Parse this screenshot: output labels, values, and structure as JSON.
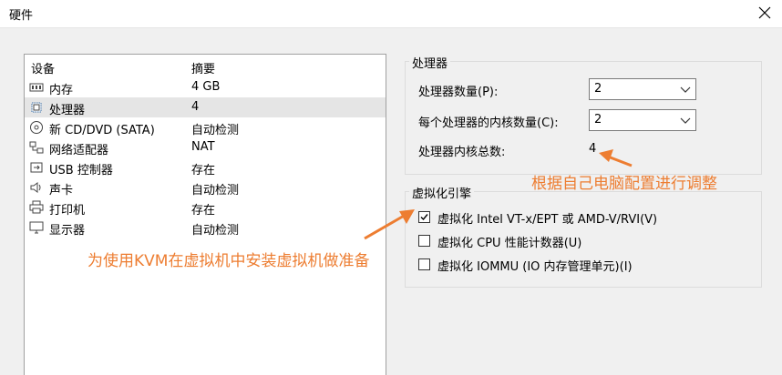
{
  "window": {
    "title": "硬件"
  },
  "device_list": {
    "headers": {
      "device": "设备",
      "summary": "摘要"
    },
    "rows": [
      {
        "name": "内存",
        "summary": "4 GB",
        "icon": "memory-icon"
      },
      {
        "name": "处理器",
        "summary": "4",
        "icon": "processor-icon",
        "selected": true
      },
      {
        "name": "新 CD/DVD (SATA)",
        "summary": "自动检测",
        "icon": "cd-dvd-icon"
      },
      {
        "name": "网络适配器",
        "summary": "NAT",
        "icon": "network-adapter-icon"
      },
      {
        "name": "USB 控制器",
        "summary": "存在",
        "icon": "usb-icon"
      },
      {
        "name": "声卡",
        "summary": "自动检测",
        "icon": "speaker-icon"
      },
      {
        "name": "打印机",
        "summary": "存在",
        "icon": "printer-icon"
      },
      {
        "name": "显示器",
        "summary": "自动检测",
        "icon": "monitor-icon"
      }
    ]
  },
  "processor_group": {
    "title": "处理器",
    "count_label": "处理器数量(P):",
    "count_value": "2",
    "cores_label": "每个处理器的内核数量(C):",
    "cores_value": "2",
    "total_label": "处理器内核总数:",
    "total_value": "4"
  },
  "virtualization_group": {
    "title": "虚拟化引擎",
    "options": [
      {
        "label": "虚拟化 Intel VT-x/EPT 或 AMD-V/RVI(V)",
        "checked": true
      },
      {
        "label": "虚拟化 CPU 性能计数器(U)",
        "checked": false
      },
      {
        "label": "虚拟化 IOMMU (IO 内存管理单元)(I)",
        "checked": false
      }
    ]
  },
  "annotations": {
    "adjust_note": "根据自己电脑配置进行调整",
    "kvm_note": "为使用KVM在虚拟机中安装虚拟机做准备"
  },
  "colors": {
    "annotation": "#ed7d31",
    "selected_row": "#e5e5e5"
  }
}
